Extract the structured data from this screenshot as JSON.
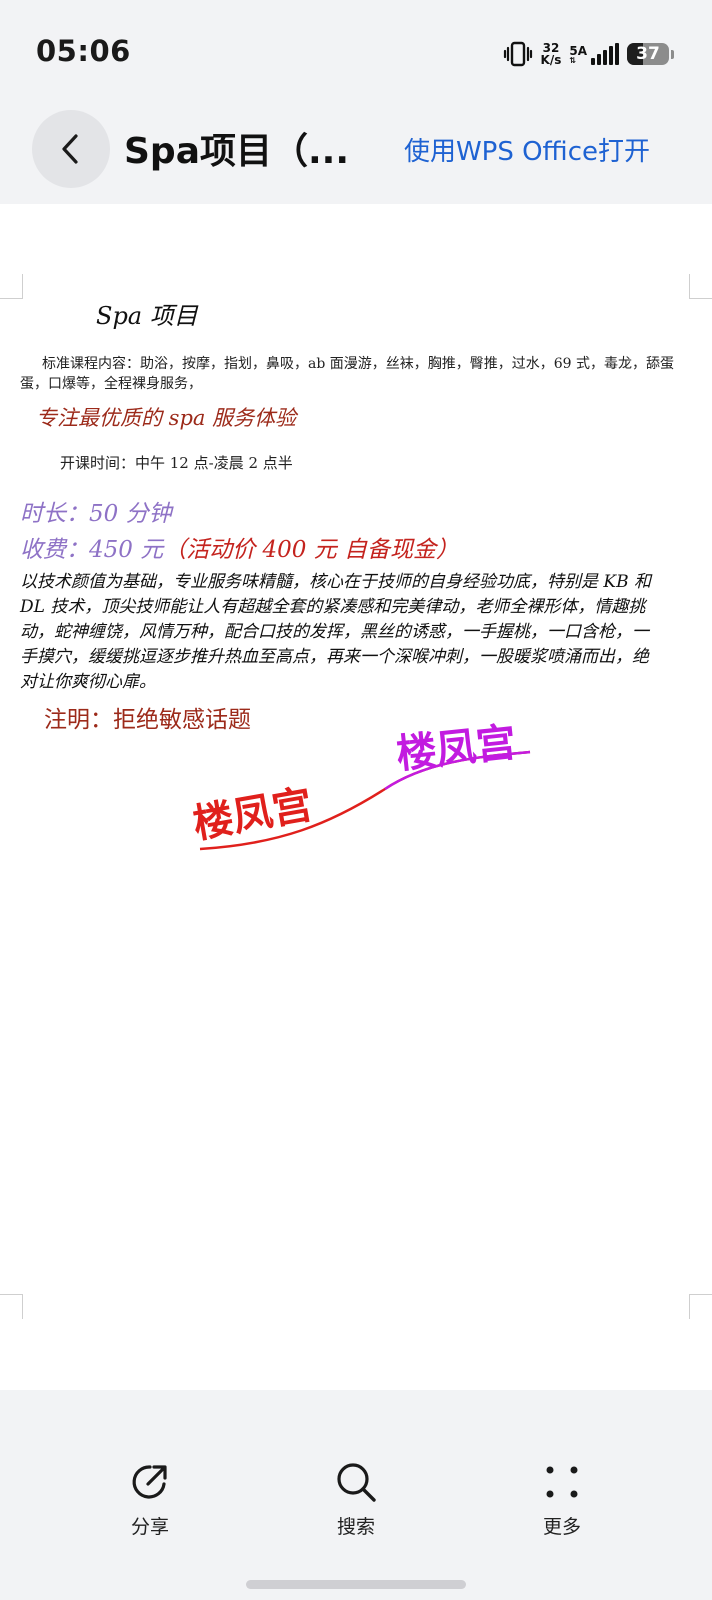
{
  "status_bar": {
    "time": "05:06",
    "net_speed_value": "32",
    "net_speed_unit": "K/s",
    "signal_label": "5A",
    "battery": "37"
  },
  "header": {
    "title": "Spa项目（...",
    "open_with": "使用WPS Office打开"
  },
  "document": {
    "title": "Spa 项目",
    "courses": "标准课程内容：助浴，按摩，指划，鼻吸，ab 面漫游，丝袜，胸推，臀推，过水，69 式，毒龙，舔蛋蛋，口爆等，全程裸身服务，",
    "slogan": "专注最优质的 spa 服务体验",
    "hours": "开课时间：中午 12 点-凌晨 2 点半",
    "duration": "时长：50 分钟",
    "price_label": "收费：450 元",
    "price_promo": "（活动价 400 元 自备现金）",
    "description": "以技术颜值为基础，专业服务味精髓，核心在于技师的自身经验功底，特别是 KB 和 DL 技术，顶尖技师能让人有超越全套的紧凑感和完美律动，老师全裸形体，情趣挑动，蛇神缠饶，风情万种，配合口技的发挥，黑丝的诱惑，一手握桃，一口含枪，一手摸穴，缓缓挑逗逐步推升热血至高点，再来一个深喉冲刺，一股暖浆喷涌而出，绝对让你爽彻心扉。",
    "note": "注明：拒绝敏感话题",
    "wordart_left": "楼凤宫",
    "wordart_right": "楼凤宫",
    "colors": {
      "slogan": "#9c2a1a",
      "duration_price": "#8e72c6",
      "promo": "#c4231e",
      "wordart_left": "#e0201c",
      "wordart_right": "#c21be0"
    }
  },
  "toolbar": {
    "share": "分享",
    "search": "搜索",
    "more": "更多"
  },
  "icons": {
    "back": "chevron-left-icon",
    "share": "share-icon",
    "search": "search-icon",
    "more": "more-grid-icon"
  }
}
